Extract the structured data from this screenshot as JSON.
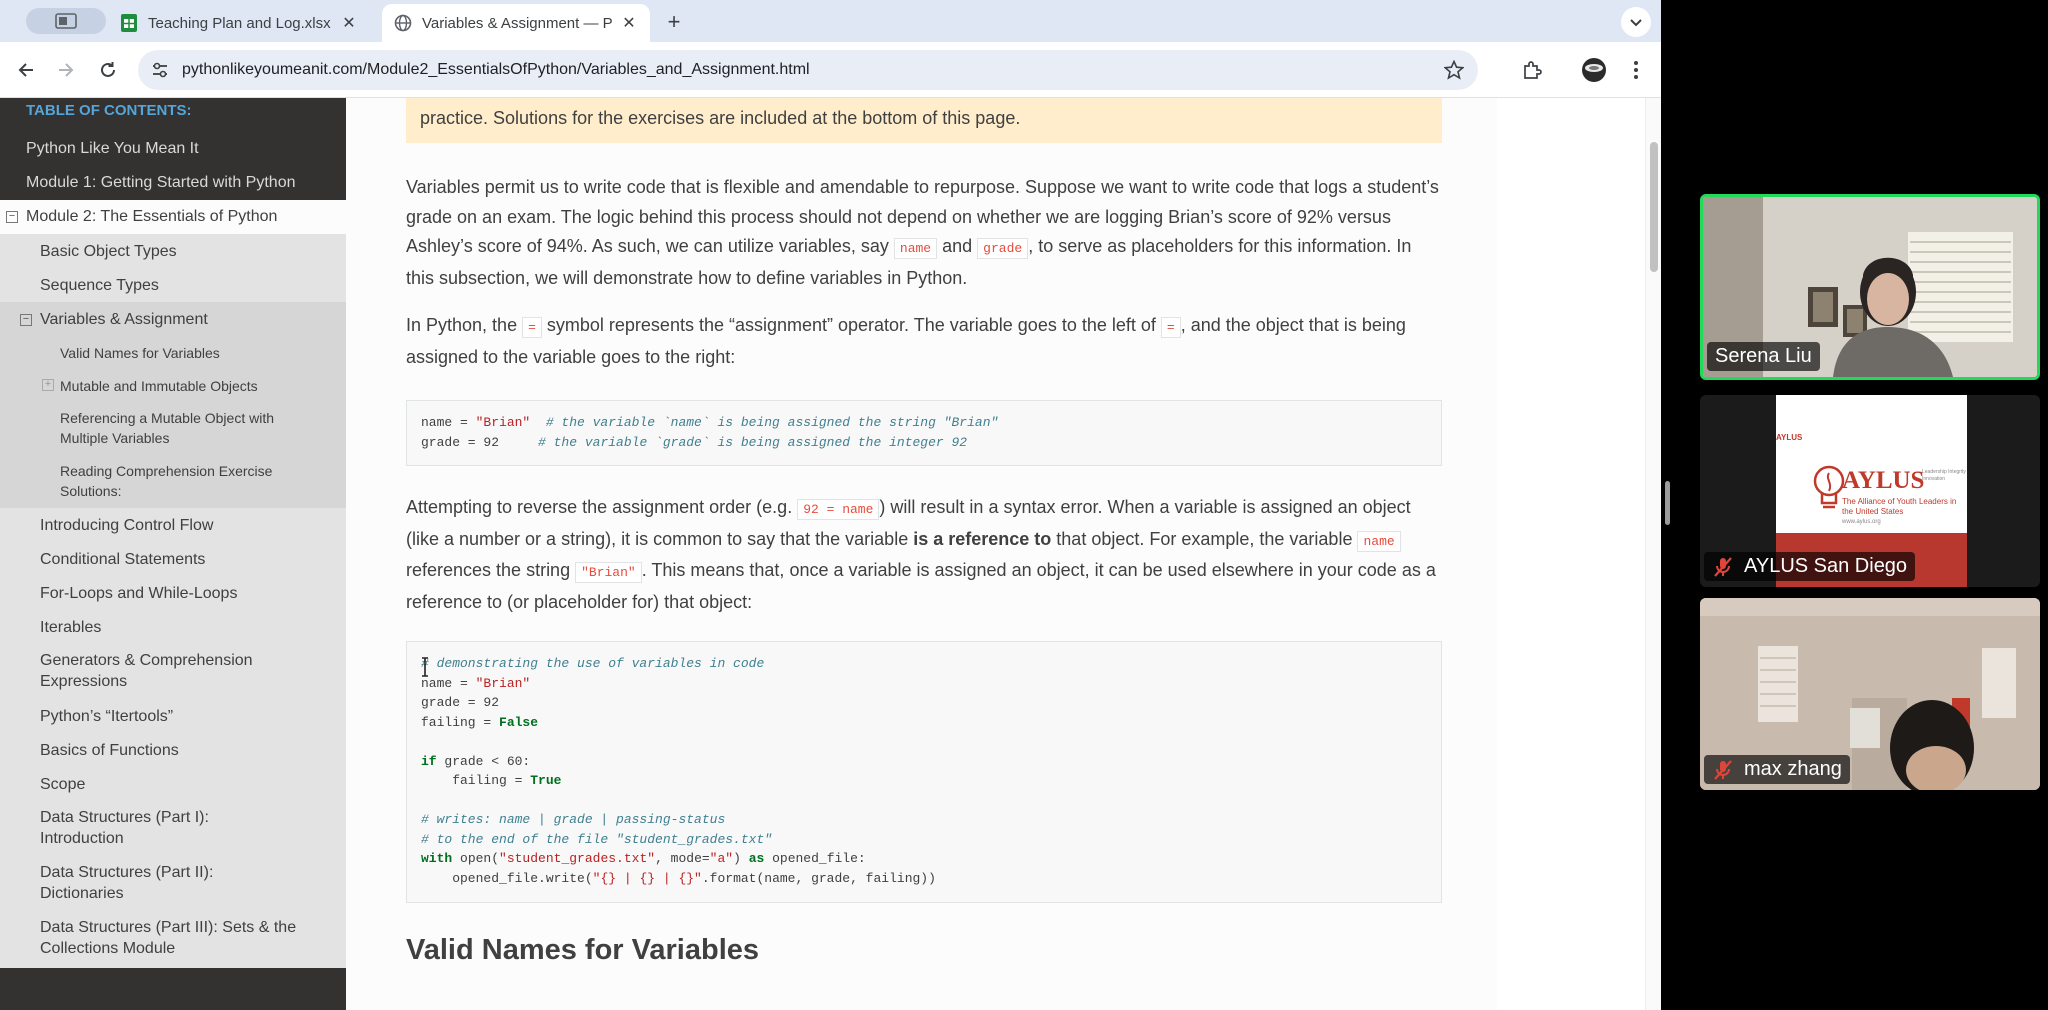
{
  "browser": {
    "tabs": [
      {
        "title": "Teaching Plan and Log.xlsx -",
        "favicon": "sheets-icon",
        "active": false
      },
      {
        "title": "Variables & Assignment — Py",
        "favicon": "globe-icon",
        "active": true
      }
    ],
    "url": "pythonlikeyoumeanit.com/Module2_EssentialsOfPython/Variables_and_Assignment.html"
  },
  "sidebar": {
    "header": "TABLE OF CONTENTS:",
    "items": [
      {
        "label": "Python Like You Mean It",
        "level": 1
      },
      {
        "label": "Module 1: Getting Started with Python",
        "level": 1
      },
      {
        "label": "Module 2: The Essentials of Python",
        "level": 1,
        "expanded": true
      },
      {
        "label": "Basic Object Types",
        "level": 2
      },
      {
        "label": "Sequence Types",
        "level": 2
      },
      {
        "label": "Variables & Assignment",
        "level": 2,
        "expanded": true
      },
      {
        "label": "Valid Names for Variables",
        "level": 3
      },
      {
        "label": "Mutable and Immutable Objects",
        "level": 3,
        "expandable": true
      },
      {
        "label": "Referencing a Mutable Object with Multiple Variables",
        "level": 3
      },
      {
        "label": "Reading Comprehension Exercise Solutions:",
        "level": 3
      },
      {
        "label": "Introducing Control Flow",
        "level": 2
      },
      {
        "label": "Conditional Statements",
        "level": 2
      },
      {
        "label": "For-Loops and While-Loops",
        "level": 2
      },
      {
        "label": "Iterables",
        "level": 2
      },
      {
        "label": "Generators & Comprehension Expressions",
        "level": 2
      },
      {
        "label": "Python’s “Itertools”",
        "level": 2
      },
      {
        "label": "Basics of Functions",
        "level": 2
      },
      {
        "label": "Scope",
        "level": 2
      },
      {
        "label": "Data Structures (Part I): Introduction",
        "level": 2
      },
      {
        "label": "Data Structures (Part II): Dictionaries",
        "level": 2
      },
      {
        "label": "Data Structures (Part III): Sets & the Collections Module",
        "level": 2
      }
    ]
  },
  "content": {
    "note": "practice. Solutions for the exercises are included at the bottom of this page.",
    "p1": {
      "a": "Variables permit us to write code that is flexible and amendable to repurpose. Suppose we want to write code that logs a student’s grade on an exam. The logic behind this process should not depend on whether we are logging Brian’s score of 92% versus Ashley’s score of 94%. As such, we can utilize variables, say ",
      "code1": "name",
      "b": " and ",
      "code2": "grade",
      "c": ", to serve as placeholders for this information. In this subsection, we will demonstrate how to define variables in Python."
    },
    "p2": {
      "a": "In Python, the ",
      "code1": "=",
      "b": " symbol represents the “assignment” operator. The variable goes to the left of ",
      "code2": "=",
      "c": ", and the object that is being assigned to the variable goes to the right:"
    },
    "code1": {
      "l1_code": "name = ",
      "l1_str": "\"Brian\"",
      "l1_com": "  # the variable `name` is being assigned the string \"Brian\"",
      "l2_code": "grade = 92     ",
      "l2_com": "# the variable `grade` is being assigned the integer 92"
    },
    "p3": {
      "a": "Attempting to reverse the assignment order (e.g. ",
      "code1": "92 = name",
      "b": ") will result in a syntax error. When a variable is assigned an object (like a number or a string), it is common to say that the variable ",
      "bold": "is a reference to",
      "c": " that object. For example, the variable ",
      "code2": "name",
      "d": " references the string ",
      "code3": "\"Brian\"",
      "e": ". This means that, once a variable is assigned an object, it can be used elsewhere in your code as a reference to (or placeholder for) that object:"
    },
    "code2": {
      "line1": "# demonstrating the use of variables in code",
      "line2a": "name = ",
      "line2b": "\"Brian\"",
      "line3": "grade = 92",
      "line4a": "failing = ",
      "line4b": "False",
      "line6a": "if",
      "line6b": " grade < 60:",
      "line7a": "    failing = ",
      "line7b": "True",
      "line9": "# writes: name | grade | passing-status",
      "line10": "# to the end of the file \"student_grades.txt\"",
      "line11a": "with",
      "line11b": " open(",
      "line11c": "\"student_grades.txt\"",
      "line11d": ", mode=",
      "line11e": "\"a\"",
      "line11f": ") ",
      "line11g": "as",
      "line11h": " opened_file:",
      "line12a": "    opened_file.write(",
      "line12b": "\"{} | {} | {}\"",
      "line12c": ".format(name, grade, failing))"
    },
    "heading": "Valid Names for Variables"
  },
  "participants": [
    {
      "name": "Serena Liu",
      "muted": false,
      "active": true
    },
    {
      "name": "AYLUS San Diego",
      "muted": true,
      "active": false
    },
    {
      "name": "max zhang",
      "muted": true,
      "active": false
    }
  ],
  "aylus_logo": {
    "small": "AYLUS",
    "big": "AYLUS",
    "tagline": "The Alliance of Youth Leaders in the United States",
    "side": "Leadership Integrity Innovation",
    "url": "www.aylus.org"
  }
}
